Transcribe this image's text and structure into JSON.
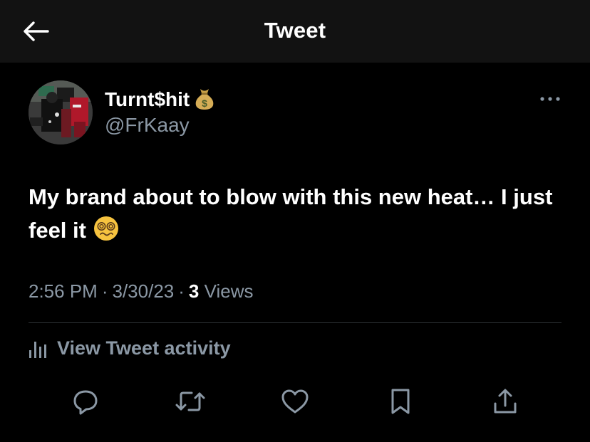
{
  "header": {
    "title": "Tweet",
    "back_icon": "arrow-left-icon"
  },
  "author": {
    "display_name": "Turnt$hit",
    "name_emoji": "money-bag-emoji",
    "handle": "@FrKaay"
  },
  "tweet": {
    "text": "My brand about to blow with this new heat… I just feel it",
    "emoji": "face-with-spiral-eyes-emoji",
    "time": "2:56 PM",
    "date": "3/30/23",
    "separator": "·",
    "views_count": "3",
    "views_label": "Views"
  },
  "activity": {
    "label": "View Tweet activity",
    "icon": "bar-chart-icon"
  },
  "actions": [
    {
      "name": "reply",
      "icon": "reply-icon"
    },
    {
      "name": "retweet",
      "icon": "retweet-icon"
    },
    {
      "name": "like",
      "icon": "heart-icon"
    },
    {
      "name": "bookmark",
      "icon": "bookmark-icon"
    },
    {
      "name": "share",
      "icon": "share-icon"
    }
  ],
  "colors": {
    "background": "#000000",
    "header_background": "#121212",
    "primary_text": "#ffffff",
    "secondary_text": "#8b98a5",
    "divider": "#2f3336"
  }
}
